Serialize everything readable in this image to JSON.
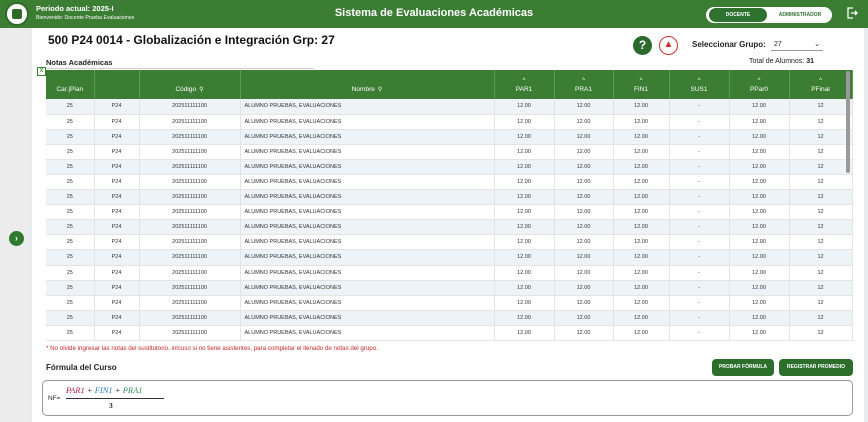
{
  "header": {
    "period": "Periodo actual: 2025-I",
    "welcome": "Bienvenido: Docente Prueba Evaluaciones",
    "app_title": "Sistema de Evaluaciones Académicas",
    "roles": [
      "DOCENTE",
      "ADMINISTRADOR"
    ],
    "active_role": "DOCENTE"
  },
  "course": {
    "title": "500 P24 0014 - Globalización e Integración Grp: 27"
  },
  "group_selector": {
    "label": "Seleccionar Grupo:",
    "value": "27"
  },
  "grades": {
    "section_title": "Notas Académicas",
    "total_label": "Total de Alumnos:",
    "total_value": "31",
    "columns": [
      "Car.|Plan",
      "Código",
      "Nombre",
      "PAR1",
      "PRA1",
      "FIN1",
      "SUS1",
      "PPar0",
      "PFinal"
    ],
    "rows": [
      [
        "25",
        "P24",
        "202511111100",
        "ALUMNO PRUEBAS, EVALUACIONES",
        "12.00",
        "12.00",
        "12.00",
        "-",
        "12.00",
        "12"
      ],
      [
        "25",
        "P24",
        "202511111100",
        "ALUMNO PRUEBAS, EVALUACIONES",
        "12.00",
        "12.00",
        "12.00",
        "-",
        "12.00",
        "12"
      ],
      [
        "25",
        "P24",
        "202511111100",
        "ALUMNO PRUEBAS, EVALUACIONES",
        "12.00",
        "12.00",
        "12.00",
        "-",
        "12.00",
        "12"
      ],
      [
        "25",
        "P24",
        "202511111100",
        "ALUMNO PRUEBAS, EVALUACIONES",
        "12.00",
        "12.00",
        "12.00",
        "-",
        "12.00",
        "12"
      ],
      [
        "25",
        "P24",
        "202511111100",
        "ALUMNO PRUEBAS, EVALUACIONES",
        "12.00",
        "12.00",
        "12.00",
        "-",
        "12.00",
        "12"
      ],
      [
        "25",
        "P24",
        "202511111100",
        "ALUMNO PRUEBAS, EVALUACIONES",
        "12.00",
        "12.00",
        "12.00",
        "-",
        "12.00",
        "12"
      ],
      [
        "25",
        "P24",
        "202511111100",
        "ALUMNO PRUEBAS, EVALUACIONES",
        "12.00",
        "12.00",
        "12.00",
        "-",
        "12.00",
        "12"
      ],
      [
        "25",
        "P24",
        "202511111100",
        "ALUMNO PRUEBAS, EVALUACIONES",
        "12.00",
        "12.00",
        "12.00",
        "-",
        "12.00",
        "12"
      ],
      [
        "25",
        "P24",
        "202511111100",
        "ALUMNO PRUEBAS, EVALUACIONES",
        "12.00",
        "12.00",
        "12.00",
        "-",
        "12.00",
        "12"
      ],
      [
        "25",
        "P24",
        "202511111100",
        "ALUMNO PRUEBAS, EVALUACIONES",
        "12.00",
        "12.00",
        "12.00",
        "-",
        "12.00",
        "12"
      ],
      [
        "25",
        "P24",
        "202511111100",
        "ALUMNO PRUEBAS, EVALUACIONES",
        "12.00",
        "12.00",
        "12.00",
        "-",
        "12.00",
        "12"
      ],
      [
        "25",
        "P24",
        "202511111100",
        "ALUMNO PRUEBAS, EVALUACIONES",
        "12.00",
        "12.00",
        "12.00",
        "-",
        "12.00",
        "12"
      ],
      [
        "25",
        "P24",
        "202511111100",
        "ALUMNO PRUEBAS, EVALUACIONES",
        "12.00",
        "12.00",
        "12.00",
        "-",
        "12.00",
        "12"
      ],
      [
        "25",
        "P24",
        "202511111100",
        "ALUMNO PRUEBAS, EVALUACIONES",
        "12.00",
        "12.00",
        "12.00",
        "-",
        "12.00",
        "12"
      ],
      [
        "25",
        "P24",
        "202511111100",
        "ALUMNO PRUEBAS, EVALUACIONES",
        "12.00",
        "12.00",
        "12.00",
        "-",
        "12.00",
        "12"
      ],
      [
        "25",
        "P24",
        "202511111100",
        "ALUMNO PRUEBAS, EVALUACIONES",
        "12.00",
        "12.00",
        "12.00",
        "-",
        "12.00",
        "12"
      ]
    ]
  },
  "note": "* No olvide ingresar las notas del sustitutorio, inlcuso si no tiene asistentes, para completar el llenado de notas del grupo.",
  "formula": {
    "title": "Fórmula del Curso",
    "prefix": "NF=",
    "term1": "PAR1",
    "term2": "FIN1",
    "term3": "PRA1",
    "operator": "+",
    "denominator": "3",
    "test_button": "PROBAR FÓRMULA",
    "register_button": "REGISTRAR PROMEDIO"
  },
  "colors": {
    "brand_green": "#3a7d33",
    "button_green": "#2d6e2d",
    "alert_red": "#c62828"
  },
  "icons": [
    "logo-icon",
    "logout-icon",
    "help-icon",
    "bell-icon",
    "search-icon",
    "sort-up-icon",
    "excel-export-icon",
    "chevron-right-icon",
    "chevron-down-icon"
  ]
}
